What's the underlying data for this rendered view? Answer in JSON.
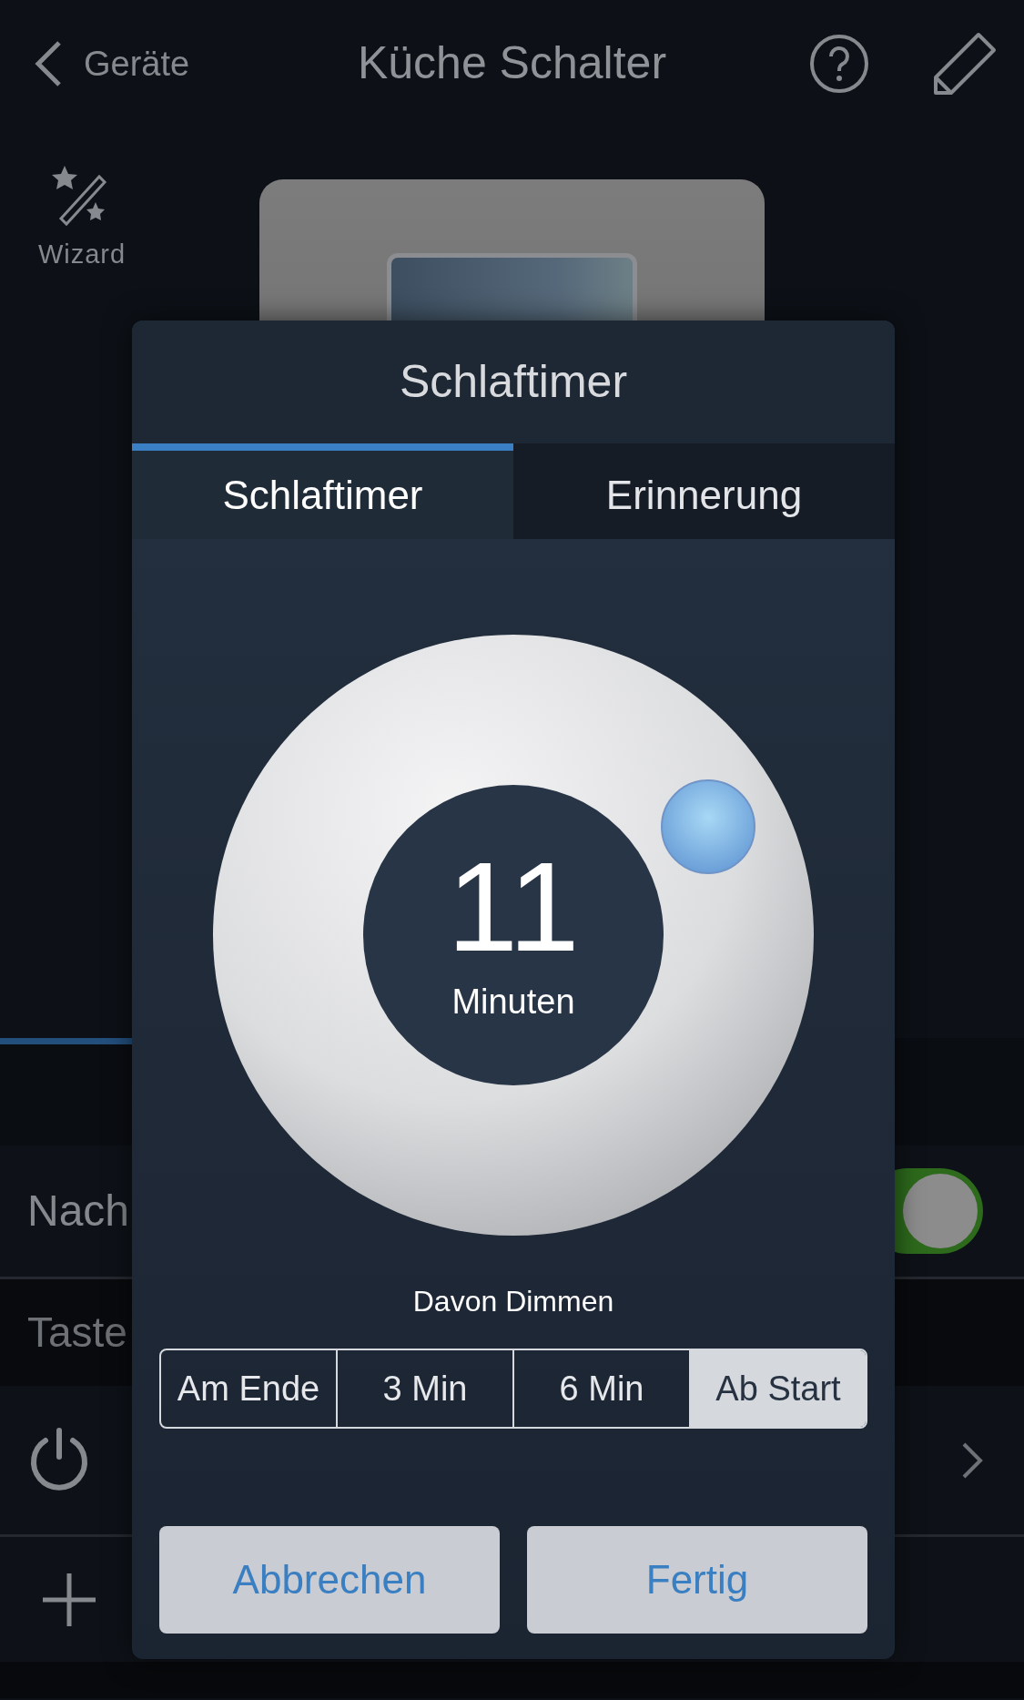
{
  "header": {
    "back_label": "Geräte",
    "title": "Küche Schalter"
  },
  "wizard": {
    "label": "Wizard"
  },
  "background": {
    "rows": [
      {
        "kind": "toggle",
        "label": "Nach",
        "on": true
      },
      {
        "kind": "section",
        "label": "Taste"
      },
      {
        "kind": "power"
      },
      {
        "kind": "add"
      }
    ]
  },
  "dialog": {
    "title": "Schlaftimer",
    "tabs": [
      {
        "label": "Schlaftimer",
        "selected": true
      },
      {
        "label": "Erinnerung",
        "selected": false
      }
    ],
    "timer": {
      "value": "11",
      "unit": "Minuten"
    },
    "dimming": {
      "label": "Davon Dimmen",
      "options": [
        {
          "label": "Am Ende",
          "selected": false
        },
        {
          "label": "3 Min",
          "selected": false
        },
        {
          "label": "6 Min",
          "selected": false
        },
        {
          "label": "Ab Start",
          "selected": true
        }
      ]
    },
    "buttons": [
      "Abbrechen",
      "Fertig"
    ]
  }
}
